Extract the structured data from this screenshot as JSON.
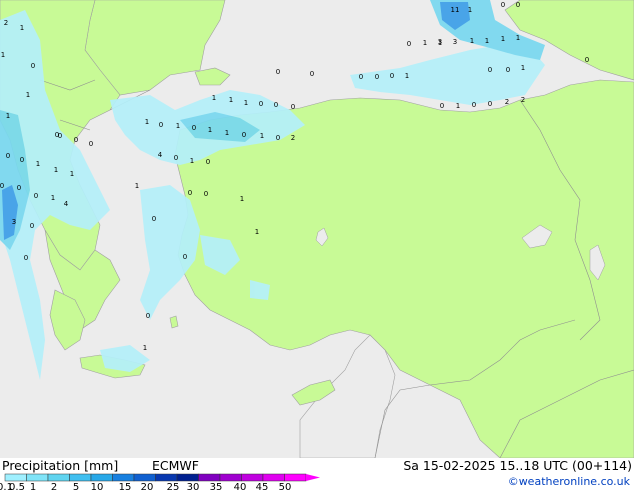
{
  "header": {
    "title": "Precipitation [mm]",
    "model": "ECMWF",
    "valid_time": "Sa 15-02-2025 15..18 UTC (00+114)",
    "copyright": "©weatheronline.co.uk"
  },
  "legend": {
    "ticks": [
      "0.1",
      "0.5",
      "1",
      "2",
      "5",
      "10",
      "15",
      "20",
      "25",
      "30",
      "35",
      "40",
      "45",
      "50"
    ],
    "colors": [
      "#a0f0ff",
      "#80e4f8",
      "#60d4f0",
      "#40bff0",
      "#28a8e8",
      "#1880e0",
      "#1060d0",
      "#0838b0",
      "#002090",
      "#8000c0",
      "#a000d0",
      "#c000e0",
      "#e000f0",
      "#ff00ff"
    ]
  },
  "map_colors": {
    "sea": "#ececec",
    "land": "#c8fa96",
    "border": "#a0a0a0",
    "precip_light": "#b4f0fa",
    "precip_mid": "#78d8f0",
    "precip_heavy": "#3c9ee8"
  },
  "precip_values": [
    "2",
    "1",
    "1",
    "0",
    "1",
    "0",
    "11",
    "1",
    "0",
    "0",
    "1",
    "1",
    "3",
    "3",
    "1",
    "1",
    "1",
    "1",
    "0",
    "0",
    "0",
    "1",
    "0",
    "0",
    "0",
    "0",
    "0",
    "0",
    "1",
    "1",
    "1",
    "1",
    "0",
    "0",
    "0",
    "0",
    "1",
    "0",
    "0",
    "2",
    "2",
    "1",
    "0",
    "1",
    "0",
    "1",
    "1",
    "0",
    "1",
    "0",
    "2",
    "1",
    "0",
    "0",
    "0",
    "0",
    "0",
    "1",
    "1",
    "1",
    "4",
    "0",
    "1",
    "0",
    "0",
    "0",
    "0",
    "1",
    "1",
    "0",
    "0",
    "1",
    "4",
    "3",
    "0",
    "1",
    "0",
    "0",
    "0",
    "0",
    "1"
  ]
}
